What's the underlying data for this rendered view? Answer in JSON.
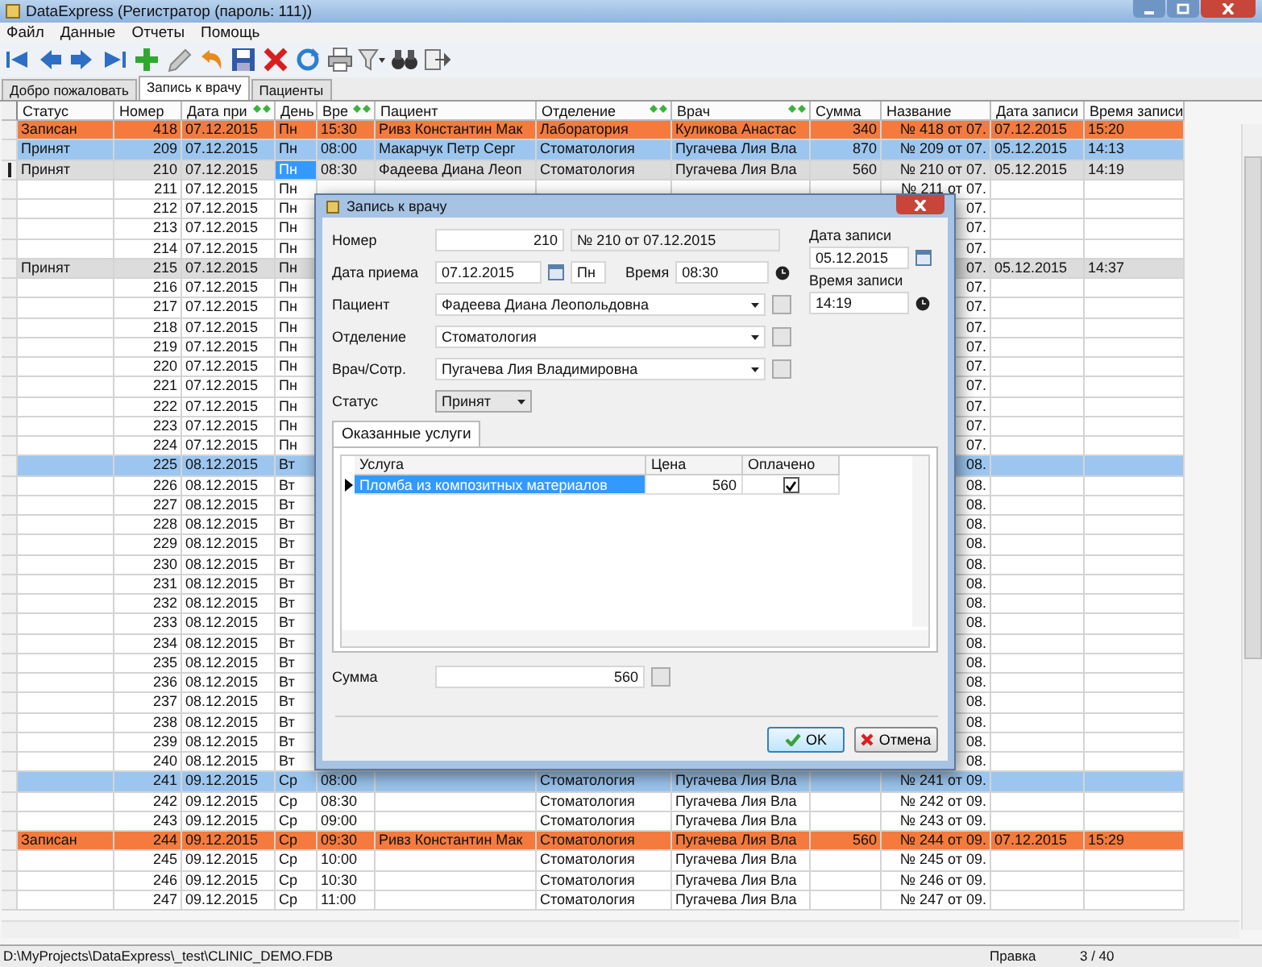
{
  "window": {
    "title": "DataExpress (Регистратор (пароль: 111))"
  },
  "menu": [
    "Файл",
    "Данные",
    "Отчеты",
    "Помощь"
  ],
  "tabs": [
    {
      "label": "Добро пожаловать",
      "selected": false
    },
    {
      "label": "Запись к врачу",
      "selected": true
    },
    {
      "label": "Пациенты",
      "selected": false
    }
  ],
  "table": {
    "columns": [
      {
        "label": "Статус",
        "sort_mark": false
      },
      {
        "label": "Номер",
        "sort_mark": false
      },
      {
        "label": "Дата при",
        "sort_mark": true
      },
      {
        "label": "День",
        "sort_mark": false
      },
      {
        "label": "Вре",
        "sort_mark": true
      },
      {
        "label": "Пациент",
        "sort_mark": false
      },
      {
        "label": "Отделение",
        "sort_mark": true
      },
      {
        "label": "Врач",
        "sort_mark": true
      },
      {
        "label": "Сумма",
        "sort_mark": false
      },
      {
        "label": "Название",
        "sort_mark": false
      },
      {
        "label": "Дата записи",
        "sort_mark": false
      },
      {
        "label": "Время записи",
        "sort_mark": false
      }
    ],
    "rows": [
      {
        "status": "Записан",
        "number": "418",
        "date": "07.12.2015",
        "day": "Пн",
        "time": "15:30",
        "patient": "Ривз Константин Мак",
        "department": "Лаборатория",
        "doctor": "Куликова Анастас",
        "sum": "340",
        "name": "№ 418 от 07.",
        "rec_date": "07.12.2015",
        "rec_time": "15:20",
        "color": "#f47b3d",
        "current": false
      },
      {
        "status": "Принят",
        "number": "209",
        "date": "07.12.2015",
        "day": "Пн",
        "time": "08:00",
        "patient": "Макарчук Петр Серг",
        "department": "Стоматология",
        "doctor": "Пугачева Лия Вла",
        "sum": "870",
        "name": "№ 209 от 07.",
        "rec_date": "05.12.2015",
        "rec_time": "14:13",
        "color": "#9cc6ef",
        "current": false
      },
      {
        "status": "Принят",
        "number": "210",
        "date": "07.12.2015",
        "day": "Пн",
        "time": "08:30",
        "patient": "Фадеева Диана Леоп",
        "department": "Стоматология",
        "doctor": "Пугачева Лия Вла",
        "sum": "560",
        "name": "№ 210 от 07.",
        "rec_date": "05.12.2015",
        "rec_time": "14:19",
        "color": "#dcdcdc",
        "current": true
      },
      {
        "number": "211",
        "date": "07.12.2015",
        "day": "Пн",
        "name": "№ 211 от 07.",
        "current": false
      },
      {
        "number": "212",
        "date": "07.12.2015",
        "day": "Пн",
        "name": "07.",
        "current": false
      },
      {
        "number": "213",
        "date": "07.12.2015",
        "day": "Пн",
        "name": "07.",
        "current": false
      },
      {
        "number": "214",
        "date": "07.12.2015",
        "day": "Пн",
        "name": "07.",
        "current": false
      },
      {
        "status": "Принят",
        "number": "215",
        "date": "07.12.2015",
        "day": "Пн",
        "name": "07.",
        "rec_date": "05.12.2015",
        "rec_time": "14:37",
        "color": "#dcdcdc",
        "current": false
      },
      {
        "number": "216",
        "date": "07.12.2015",
        "day": "Пн",
        "name": "07.",
        "current": false
      },
      {
        "number": "217",
        "date": "07.12.2015",
        "day": "Пн",
        "name": "07.",
        "current": false
      },
      {
        "number": "218",
        "date": "07.12.2015",
        "day": "Пн",
        "name": "07.",
        "current": false
      },
      {
        "number": "219",
        "date": "07.12.2015",
        "day": "Пн",
        "name": "07.",
        "current": false
      },
      {
        "number": "220",
        "date": "07.12.2015",
        "day": "Пн",
        "name": "07.",
        "current": false
      },
      {
        "number": "221",
        "date": "07.12.2015",
        "day": "Пн",
        "name": "07.",
        "current": false
      },
      {
        "number": "222",
        "date": "07.12.2015",
        "day": "Пн",
        "name": "07.",
        "current": false
      },
      {
        "number": "223",
        "date": "07.12.2015",
        "day": "Пн",
        "name": "07.",
        "current": false
      },
      {
        "number": "224",
        "date": "07.12.2015",
        "day": "Пн",
        "name": "07.",
        "current": false
      },
      {
        "number": "225",
        "date": "08.12.2015",
        "day": "Вт",
        "name": "08.",
        "color": "#9cc6ef",
        "current": false
      },
      {
        "number": "226",
        "date": "08.12.2015",
        "day": "Вт",
        "name": "08.",
        "current": false
      },
      {
        "number": "227",
        "date": "08.12.2015",
        "day": "Вт",
        "name": "08.",
        "current": false
      },
      {
        "number": "228",
        "date": "08.12.2015",
        "day": "Вт",
        "name": "08.",
        "current": false
      },
      {
        "number": "229",
        "date": "08.12.2015",
        "day": "Вт",
        "name": "08.",
        "current": false
      },
      {
        "number": "230",
        "date": "08.12.2015",
        "day": "Вт",
        "name": "08.",
        "current": false
      },
      {
        "number": "231",
        "date": "08.12.2015",
        "day": "Вт",
        "name": "08.",
        "current": false
      },
      {
        "number": "232",
        "date": "08.12.2015",
        "day": "Вт",
        "name": "08.",
        "current": false
      },
      {
        "number": "233",
        "date": "08.12.2015",
        "day": "Вт",
        "name": "08.",
        "current": false
      },
      {
        "number": "234",
        "date": "08.12.2015",
        "day": "Вт",
        "name": "08.",
        "current": false
      },
      {
        "number": "235",
        "date": "08.12.2015",
        "day": "Вт",
        "name": "08.",
        "current": false
      },
      {
        "number": "236",
        "date": "08.12.2015",
        "day": "Вт",
        "name": "08.",
        "current": false
      },
      {
        "number": "237",
        "date": "08.12.2015",
        "day": "Вт",
        "name": "08.",
        "current": false
      },
      {
        "number": "238",
        "date": "08.12.2015",
        "day": "Вт",
        "name": "08.",
        "current": false
      },
      {
        "number": "239",
        "date": "08.12.2015",
        "day": "Вт",
        "name": "08.",
        "current": false
      },
      {
        "number": "240",
        "date": "08.12.2015",
        "day": "Вт",
        "name": "08.",
        "current": false
      },
      {
        "number": "241",
        "date": "09.12.2015",
        "day": "Ср",
        "time": "08:00",
        "department": "Стоматология",
        "doctor": "Пугачева Лия Вла",
        "name": "№ 241 от 09.",
        "color": "#9cc6ef",
        "current": false
      },
      {
        "number": "242",
        "date": "09.12.2015",
        "day": "Ср",
        "time": "08:30",
        "department": "Стоматология",
        "doctor": "Пугачева Лия Вла",
        "name": "№ 242 от 09.",
        "current": false
      },
      {
        "number": "243",
        "date": "09.12.2015",
        "day": "Ср",
        "time": "09:00",
        "department": "Стоматология",
        "doctor": "Пугачева Лия Вла",
        "name": "№ 243 от 09.",
        "current": false
      },
      {
        "status": "Записан",
        "number": "244",
        "date": "09.12.2015",
        "day": "Ср",
        "time": "09:30",
        "patient": "Ривз Константин Мак",
        "department": "Стоматология",
        "doctor": "Пугачева Лия Вла",
        "sum": "560",
        "name": "№ 244 от 09.",
        "rec_date": "07.12.2015",
        "rec_time": "15:29",
        "color": "#f47b3d",
        "current": false
      },
      {
        "number": "245",
        "date": "09.12.2015",
        "day": "Ср",
        "time": "10:00",
        "department": "Стоматология",
        "doctor": "Пугачева Лия Вла",
        "name": "№ 245 от 09.",
        "current": false
      },
      {
        "number": "246",
        "date": "09.12.2015",
        "day": "Ср",
        "time": "10:30",
        "department": "Стоматология",
        "doctor": "Пугачева Лия Вла",
        "name": "№ 246 от 09.",
        "current": false
      },
      {
        "number": "247",
        "date": "09.12.2015",
        "day": "Ср",
        "time": "11:00",
        "department": "Стоматология",
        "doctor": "Пугачева Лия Вла",
        "name": "№ 247 от 09.",
        "current": false
      }
    ]
  },
  "dialog": {
    "title": "Запись к врачу",
    "number": {
      "label": "Номер",
      "value": "210"
    },
    "caption": "№ 210 от 07.12.2015",
    "visit_date": {
      "label": "Дата приема",
      "value": "07.12.2015"
    },
    "weekday": "Пн",
    "time": {
      "label": "Время",
      "value": "08:30"
    },
    "record_date": {
      "label": "Дата записи",
      "value": "05.12.2015"
    },
    "record_time": {
      "label": "Время записи",
      "value": "14:19"
    },
    "lookups": [
      {
        "label": "Пациент",
        "value": "Фадеева Диана Леопольдовна"
      },
      {
        "label": "Отделение",
        "value": "Стоматология"
      },
      {
        "label": "Врач/Сотр.",
        "value": "Пугачева Лия Владимировна"
      }
    ],
    "status": {
      "label": "Статус",
      "value": "Принят"
    },
    "services": {
      "tab": "Оказанные услуги",
      "columns": [
        "Услуга",
        "Цена",
        "Оплачено"
      ],
      "rows": [
        {
          "service": "Пломба из композитных материалов",
          "price": "560",
          "paid": true,
          "selected": true
        }
      ]
    },
    "total": {
      "label": "Сумма",
      "value": "560"
    },
    "buttons": [
      {
        "label": "OK",
        "kind": "ok"
      },
      {
        "label": "Отмена",
        "kind": "cancel"
      }
    ]
  },
  "status_bar": {
    "path": "D:\\MyProjects\\DataExpress\\_test\\CLINIC_DEMO.FDB",
    "mode": "Правка",
    "position": "3 / 40"
  }
}
